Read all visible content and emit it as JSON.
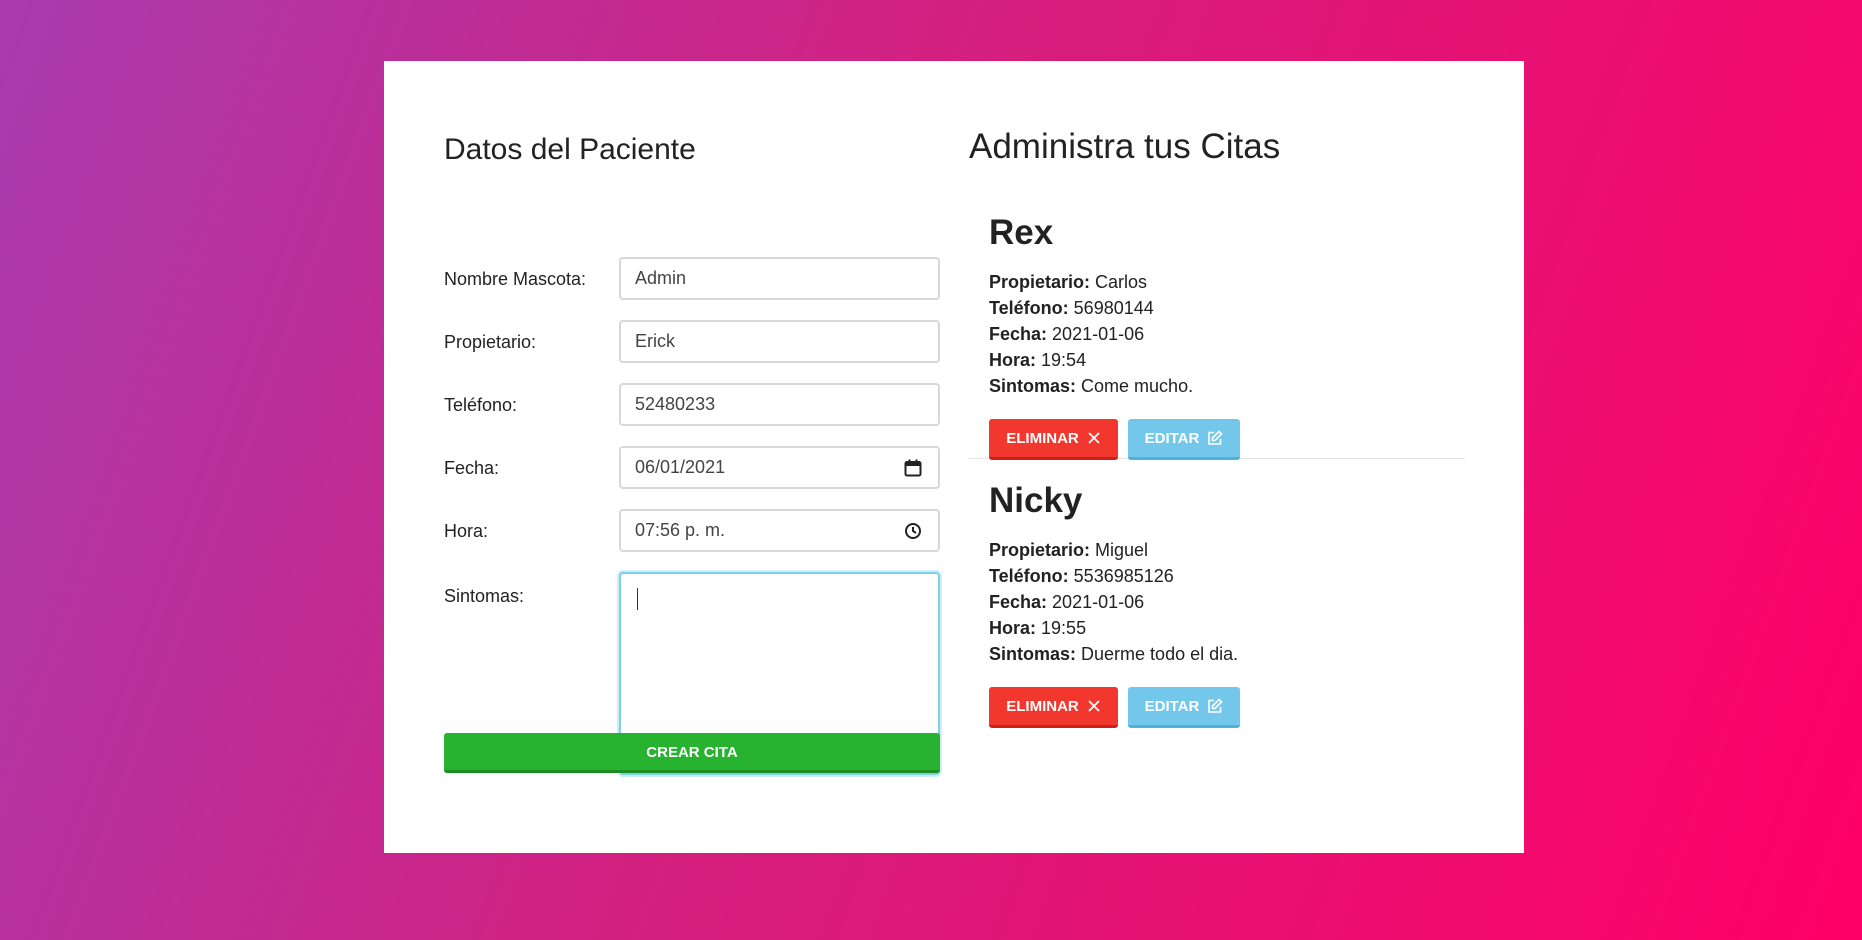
{
  "form": {
    "title": "Datos del Paciente",
    "fields": [
      {
        "label": "Nombre Mascota:",
        "value": "Admin"
      },
      {
        "label": "Propietario:",
        "value": "Erick"
      },
      {
        "label": "Teléfono:",
        "value": "52480233"
      },
      {
        "label": "Fecha:",
        "value": "06/01/2021",
        "icon": "calendar-icon"
      },
      {
        "label": "Hora:",
        "value": "07:56 p. m.",
        "icon": "clock-icon"
      },
      {
        "label": "Sintomas:",
        "value": ""
      }
    ],
    "submit_label": "Crear Cita"
  },
  "list": {
    "title": "Administra tus Citas",
    "labels": {
      "owner": "Propietario:",
      "phone": "Teléfono:",
      "date": "Fecha:",
      "time": "Hora:",
      "symptoms": "Sintomas:"
    },
    "delete_label": "Eliminar",
    "edit_label": "Editar",
    "items": [
      {
        "name": "Rex",
        "owner": "Carlos",
        "phone": "56980144",
        "date": "2021-01-06",
        "time": "19:54",
        "symptoms": "Come mucho."
      },
      {
        "name": "Nicky",
        "owner": "Miguel",
        "phone": "5536985126",
        "date": "2021-01-06",
        "time": "19:55",
        "symptoms": "Duerme todo el dia."
      }
    ]
  },
  "colors": {
    "submit": "#27b330",
    "delete": "#f2372f",
    "edit": "#72c7ea",
    "background_start": "#a93bae",
    "background_end": "#ff0066"
  }
}
